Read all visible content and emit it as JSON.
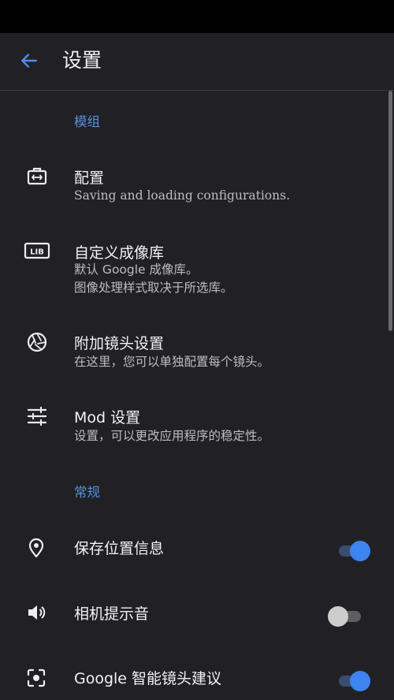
{
  "header": {
    "title": "设置"
  },
  "sections": {
    "modules": {
      "title": "模组"
    },
    "general": {
      "title": "常规"
    }
  },
  "items": {
    "config": {
      "title": "配置",
      "subtitle": "Saving and loading configurations."
    },
    "library": {
      "title": "自定义成像库",
      "subtitle_1": "默认 Google 成像库。",
      "subtitle_2": "图像处理样式取决于所选库。",
      "icon_text": "LIB"
    },
    "lens": {
      "title": "附加镜头设置",
      "subtitle": "在这里，您可以单独配置每个镜头。"
    },
    "mod": {
      "title": "Mod 设置",
      "subtitle": "设置，可以更改应用程序的稳定性。"
    },
    "location": {
      "title": "保存位置信息",
      "enabled": true
    },
    "sound": {
      "title": "相机提示音",
      "enabled": false
    },
    "lens_suggest": {
      "title": "Google 智能镜头建议",
      "enabled": true
    }
  },
  "colors": {
    "accent": "#3E84EE",
    "section": "#5B8FD9",
    "background": "#212125"
  }
}
